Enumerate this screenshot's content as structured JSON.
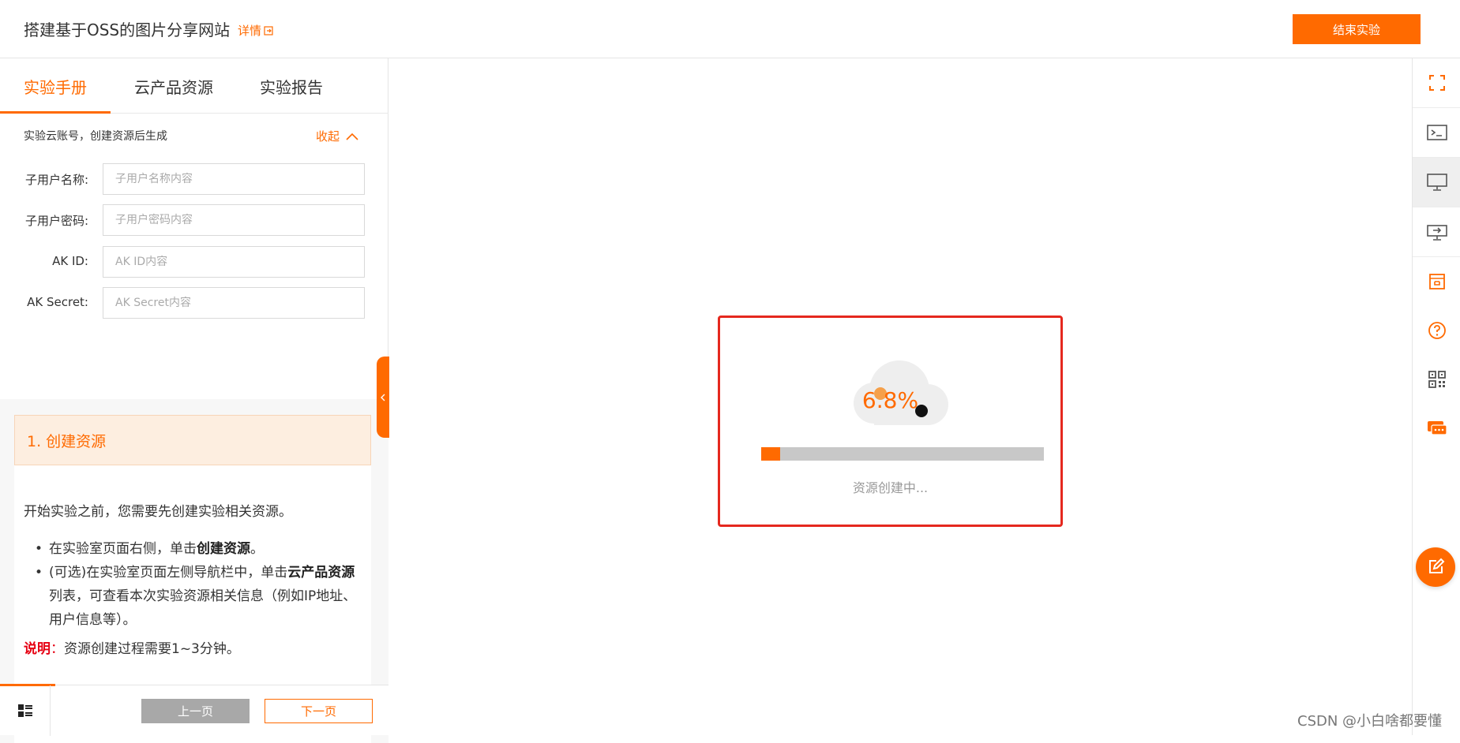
{
  "header": {
    "title": "搭建基于OSS的图片分享网站",
    "detail_link": "详情",
    "end_button": "结束实验"
  },
  "tabs": [
    {
      "label": "实验手册",
      "active": true
    },
    {
      "label": "云产品资源",
      "active": false
    },
    {
      "label": "实验报告",
      "active": false
    }
  ],
  "account": {
    "heading": "实验云账号，创建资源后生成",
    "collapse_label": "收起",
    "fields": [
      {
        "label": "子用户名称:",
        "value": "",
        "placeholder": "子用户名称内容"
      },
      {
        "label": "子用户密码:",
        "value": "",
        "placeholder": "子用户密码内容"
      },
      {
        "label": "AK ID:",
        "value": "",
        "placeholder": "AK ID内容"
      },
      {
        "label": "AK Secret:",
        "value": "",
        "placeholder": "AK Secret内容"
      }
    ]
  },
  "guide": {
    "step_title": "1. 创建资源",
    "intro": "开始实验之前，您需要先创建实验相关资源。",
    "bullets": [
      {
        "prefix": "在实验室页面右侧，单击",
        "bold": "创建资源",
        "suffix": "。"
      },
      {
        "prefix": "(可选)在实验室页面左侧导航栏中，单击",
        "bold": "云产品资源",
        "suffix": "列表，可查看本次实验资源相关信息（例如IP地址、用户信息等）。"
      }
    ],
    "note_key": "说明",
    "note_sep": "：",
    "note_text": "资源创建过程需要1~3分钟。"
  },
  "pager": {
    "prev_label": "上一页",
    "next_label": "下一页"
  },
  "loading": {
    "percent_text": "6.8%",
    "progress": 0.068,
    "status_text": "资源创建中..."
  },
  "right_toolbar": {
    "icons": [
      "fullscreen-icon",
      "terminal-icon",
      "desktop-icon",
      "remote-desktop-icon",
      "archive-icon",
      "help-icon",
      "qrcode-icon",
      "chat-icon"
    ],
    "fab_icon": "edit-icon"
  },
  "watermark": "CSDN @小白啥都要懂",
  "colors": {
    "accent": "#ff6a00",
    "highlight_border": "#e5281e",
    "note_red": "#e60012"
  }
}
